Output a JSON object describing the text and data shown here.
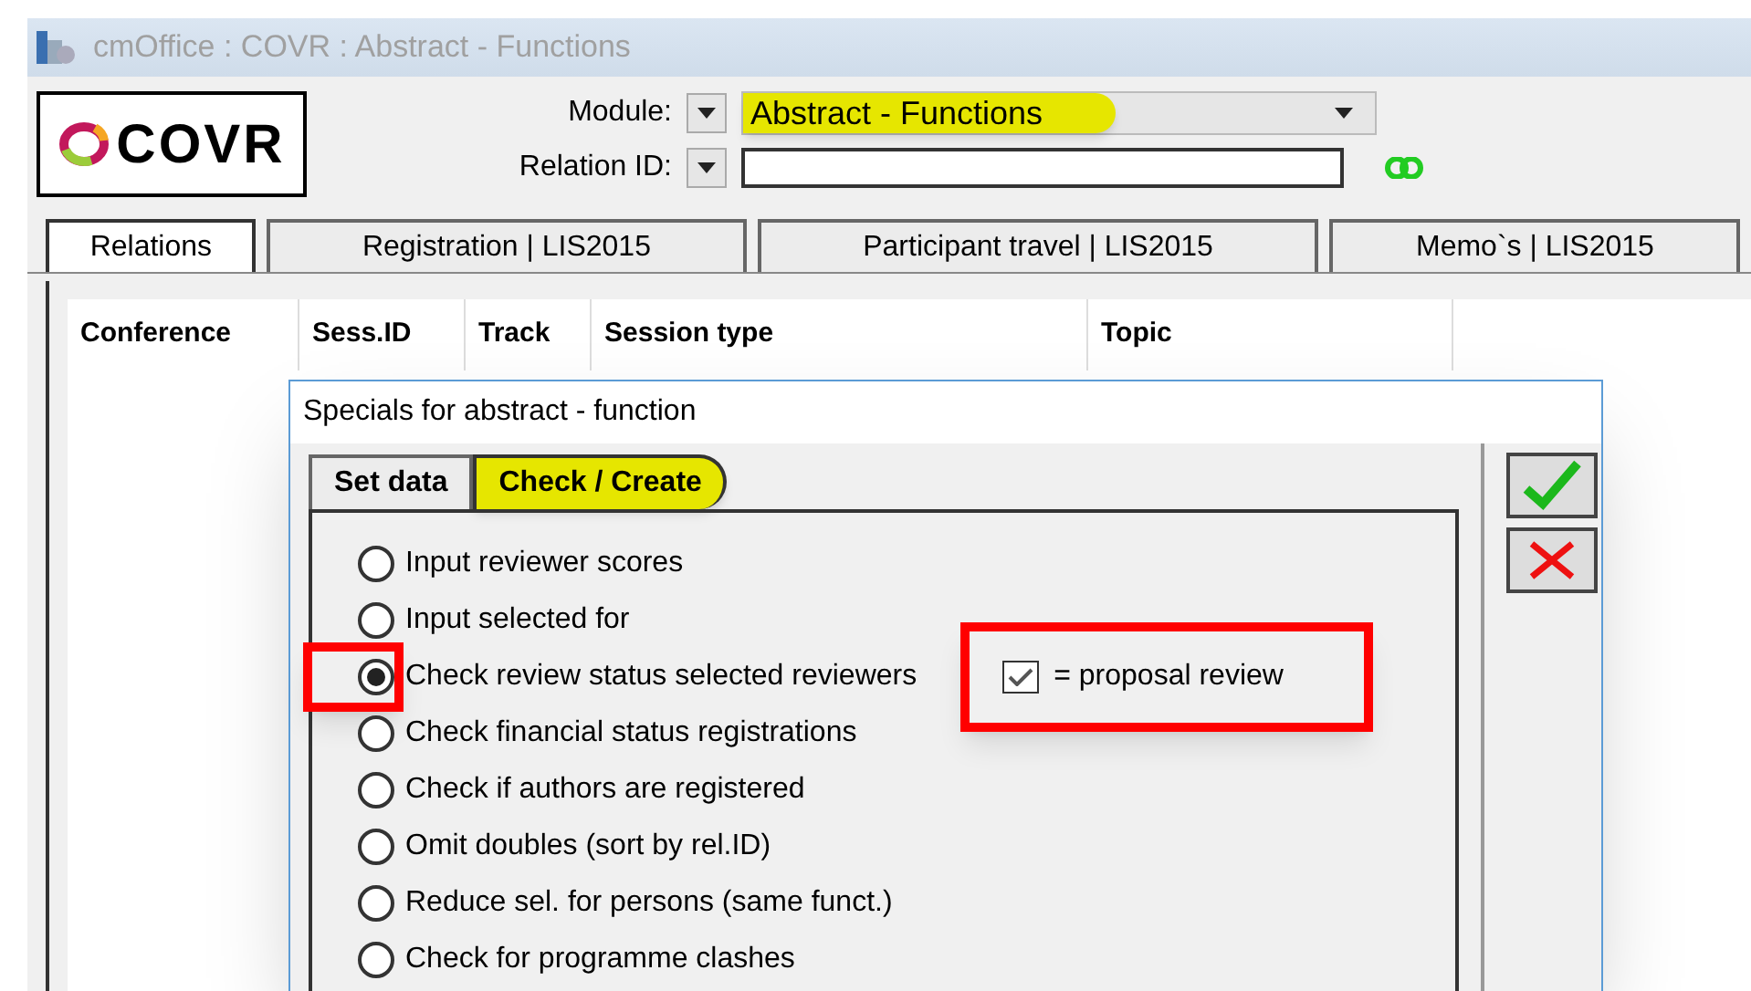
{
  "window": {
    "title": "cmOffice : COVR : Abstract - Functions"
  },
  "logo": {
    "text": "COVR"
  },
  "module": {
    "label": "Module:",
    "value": "Abstract - Functions",
    "highlighted": true
  },
  "relation_id": {
    "label": "Relation ID:"
  },
  "tabs": [
    {
      "label": "Relations",
      "selected": true
    },
    {
      "label": "Registration | LIS2015",
      "selected": false
    },
    {
      "label": "Participant travel | LIS2015",
      "selected": false
    },
    {
      "label": "Memo`s | LIS2015",
      "selected": false
    }
  ],
  "table": {
    "columns": [
      "Conference",
      "Sess.ID",
      "Track",
      "Session type",
      "Topic"
    ]
  },
  "dialog": {
    "title": "Specials for abstract - function",
    "tabs": [
      {
        "label": "Set data",
        "selected": false,
        "highlighted": false
      },
      {
        "label": "Check / Create",
        "selected": true,
        "highlighted": true
      }
    ],
    "options": [
      {
        "label": "Input reviewer scores",
        "selected": false,
        "annotated": false
      },
      {
        "label": "Input selected for",
        "selected": false,
        "annotated": false
      },
      {
        "label": "Check review status selected reviewers",
        "selected": true,
        "annotated": true
      },
      {
        "label": "Check financial status registrations",
        "selected": false,
        "annotated": false
      },
      {
        "label": "Check if authors are registered",
        "selected": false,
        "annotated": false
      },
      {
        "label": "Omit doubles (sort by rel.ID)",
        "selected": false,
        "annotated": false
      },
      {
        "label": "Reduce sel. for persons (same funct.)",
        "selected": false,
        "annotated": false
      },
      {
        "label": "Check for programme clashes",
        "selected": false,
        "annotated": false
      }
    ],
    "checkbox": {
      "label": "= proposal review",
      "checked": true,
      "annotated": true
    }
  }
}
